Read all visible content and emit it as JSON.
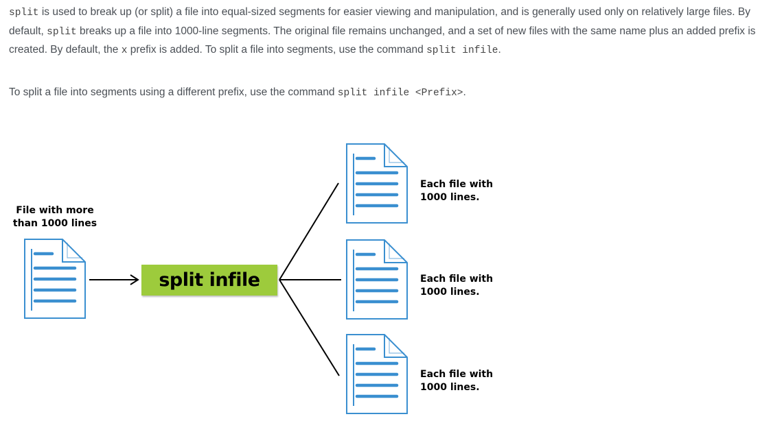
{
  "paragraph1": {
    "code1": "split",
    "text1": " is used to break up (or split) a file into equal-sized segments for easier viewing and manipulation, and is generally used only on relatively large files. By default, ",
    "code2": "split",
    "text2": " breaks up a file into 1000-line segments. The original file remains unchanged, and a set of new files with the same name plus an added prefix is created. By default, the ",
    "code3": "x",
    "text3": " prefix is added. To split a file into segments, use the command ",
    "code4": "split infile",
    "text4": "."
  },
  "paragraph2": {
    "text1": "To split a file into segments using a different prefix, use the command ",
    "code1": "split infile <Prefix>",
    "text2": "."
  },
  "diagram": {
    "source_label": [
      "File with more",
      "than 1000 lines"
    ],
    "command": "split infile",
    "output_labels": [
      [
        "Each file with",
        "1000 lines."
      ],
      [
        "Each file with",
        "1000 lines."
      ],
      [
        "Each file with",
        "1000 lines."
      ]
    ],
    "icon": "document-icon",
    "colors": {
      "icon_stroke": "#3a8fd0",
      "command_fill": "#9dcb3c",
      "text": "#4a4f55"
    }
  }
}
